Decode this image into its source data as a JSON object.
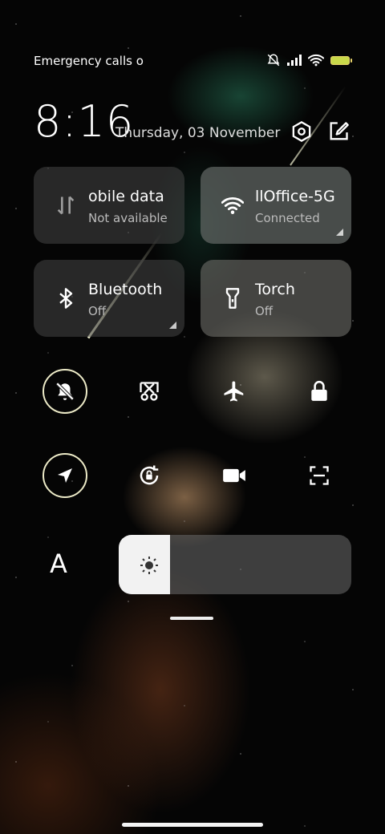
{
  "status_bar": {
    "carrier": "Emergency calls o",
    "icons": [
      "mute-icon",
      "signal-icon",
      "wifi-icon",
      "battery-icon"
    ]
  },
  "header": {
    "time": "8:16",
    "date": "Thursday, 03 November",
    "icons": [
      "settings-icon",
      "edit-icon"
    ]
  },
  "tiles": {
    "mobile_data": {
      "title": "obile data",
      "subtitle": "Not available"
    },
    "wifi": {
      "title": "llOffice-5G",
      "subtitle": "Connected"
    },
    "bluetooth": {
      "title": "Bluetooth",
      "subtitle": "Off"
    },
    "torch": {
      "title": "Torch",
      "subtitle": "Off"
    }
  },
  "toggles_row1": [
    "mute-icon",
    "screenshot-icon",
    "airplane-icon",
    "lock-icon"
  ],
  "toggles_row2": [
    "location-icon",
    "rotation-lock-icon",
    "video-icon",
    "scanner-icon"
  ],
  "brightness": {
    "font_label": "A",
    "level_percent": 22
  },
  "colors": {
    "ring": "#eceac7",
    "battery": "#c9d94a"
  }
}
